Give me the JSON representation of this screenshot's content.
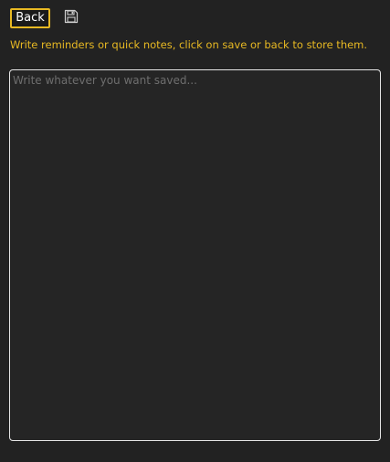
{
  "toolbar": {
    "back_label": "Back",
    "save_icon": "floppy-disk-icon"
  },
  "hint_text": "Write reminders or quick notes, click on save or back to store them.",
  "note": {
    "value": "",
    "placeholder": "Write whatever you want saved..."
  },
  "colors": {
    "background": "#222222",
    "accent": "#e8b923",
    "text_area_bg": "#252525",
    "text_area_border": "#e6e6e6"
  }
}
